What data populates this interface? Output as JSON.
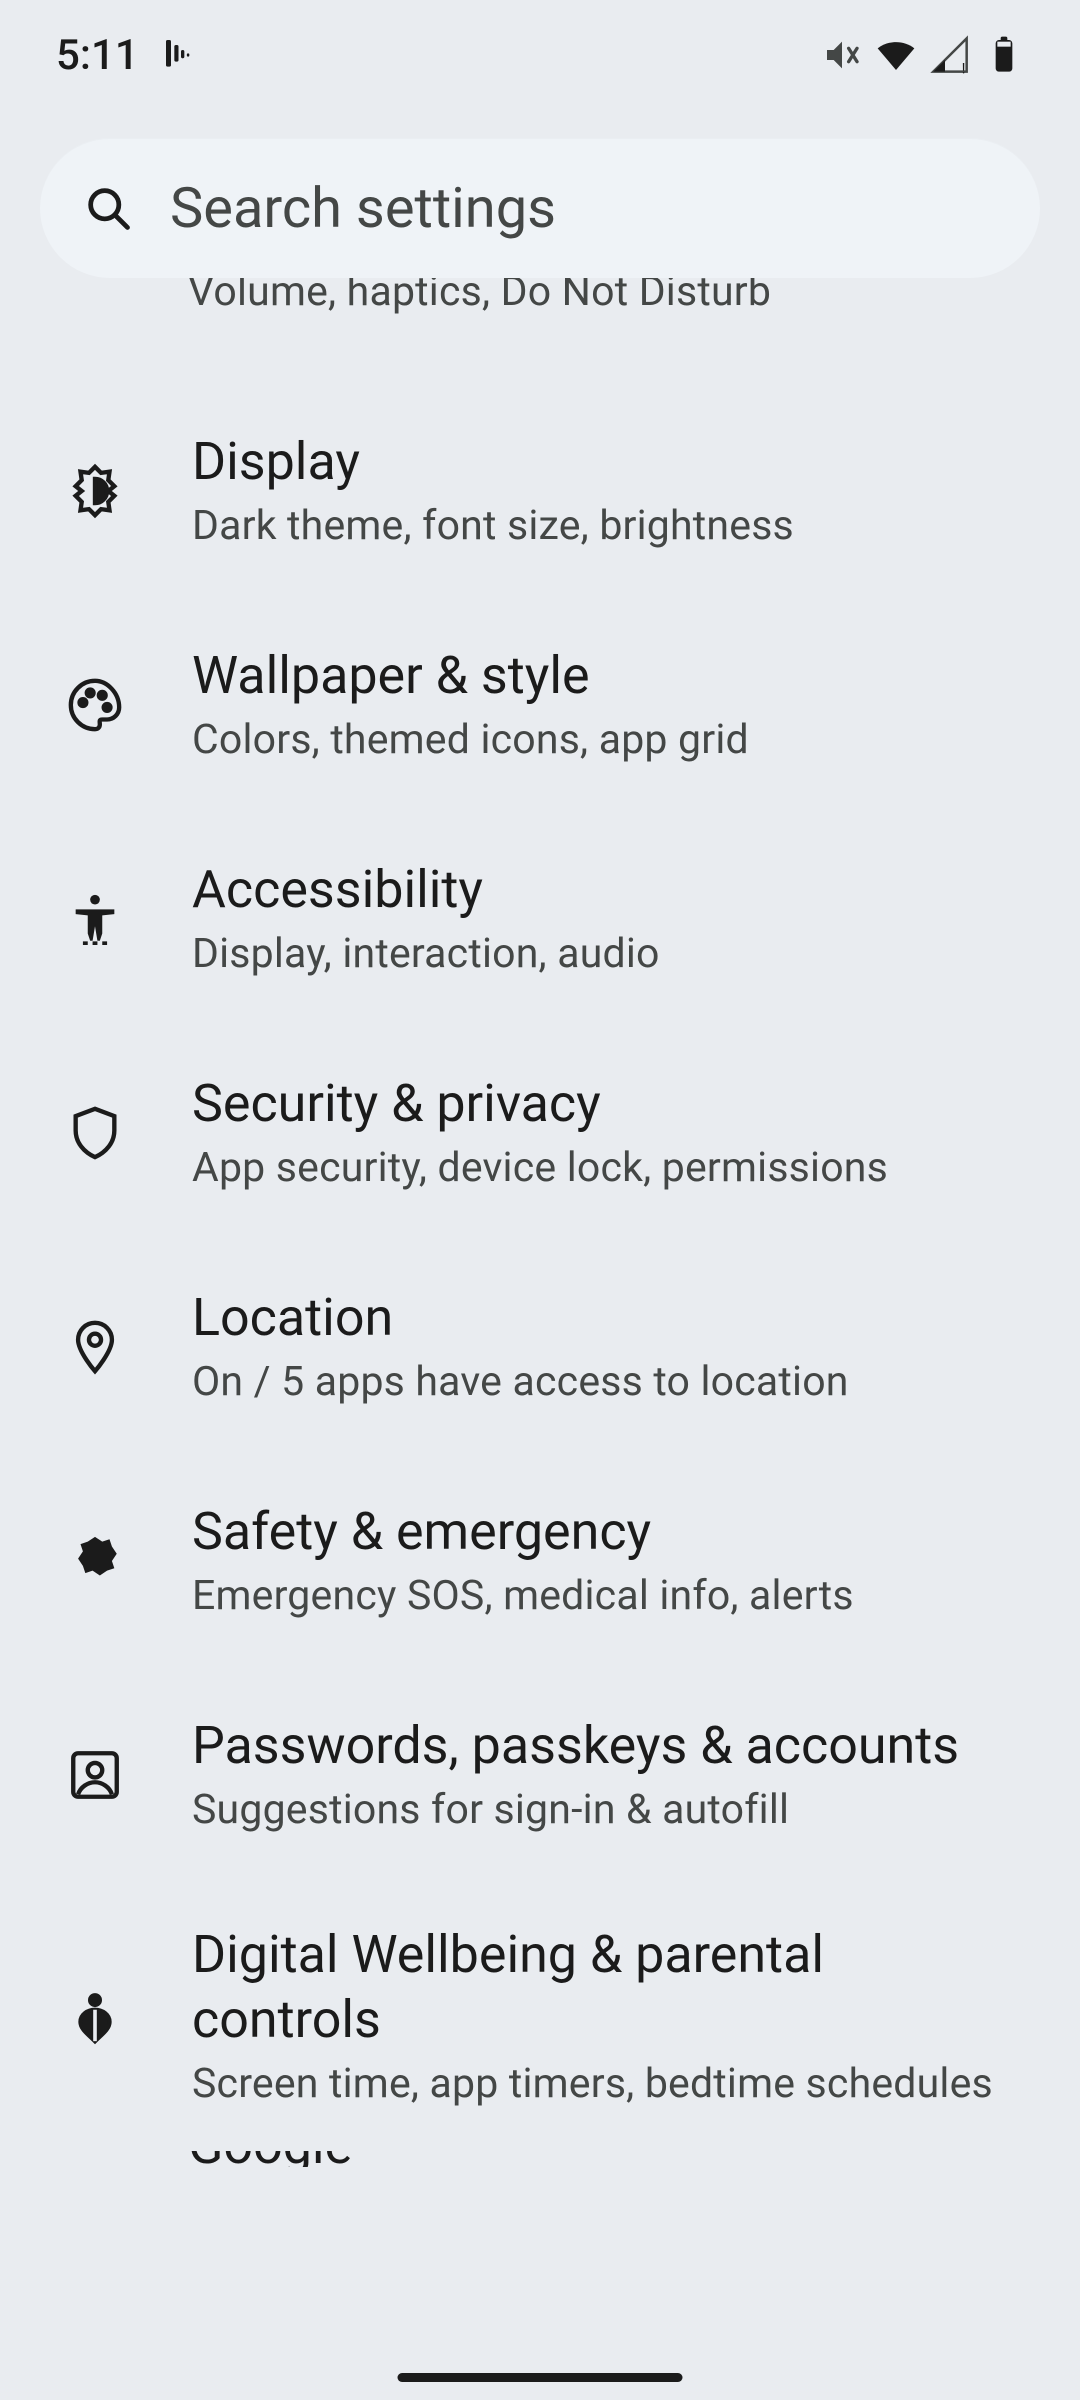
{
  "status": {
    "time": "5:11",
    "icons": {
      "notification": "music-notification",
      "mute": "volume-muted",
      "wifi": "wifi-full",
      "signal": "cellular-weak-alert",
      "battery": "battery-high"
    }
  },
  "search": {
    "placeholder": "Search settings"
  },
  "prev_item": {
    "subtitle": "Volume, haptics, Do Not Disturb"
  },
  "items": [
    {
      "id": "display",
      "icon": "brightness-icon",
      "title": "Display",
      "subtitle": "Dark theme, font size, brightness"
    },
    {
      "id": "wallpaper",
      "icon": "palette-icon",
      "title": "Wallpaper & style",
      "subtitle": "Colors, themed icons, app grid"
    },
    {
      "id": "accessibility",
      "icon": "accessibility-icon",
      "title": "Accessibility",
      "subtitle": "Display, interaction, audio"
    },
    {
      "id": "security",
      "icon": "shield-icon",
      "title": "Security & privacy",
      "subtitle": "App security, device lock, permissions"
    },
    {
      "id": "location",
      "icon": "location-icon",
      "title": "Location",
      "subtitle": "On / 5 apps have access to location"
    },
    {
      "id": "safety",
      "icon": "medical-icon",
      "title": "Safety & emergency",
      "subtitle": "Emergency SOS, medical info, alerts"
    },
    {
      "id": "passwords",
      "icon": "account-box-icon",
      "title": "Passwords, passkeys & accounts",
      "subtitle": "Suggestions for sign-in & autofill"
    },
    {
      "id": "wellbeing",
      "icon": "wellbeing-icon",
      "title": "Digital Wellbeing & parental controls",
      "subtitle": "Screen time, app timers, bedtime schedules"
    }
  ],
  "next_item": {
    "title": "Google"
  }
}
